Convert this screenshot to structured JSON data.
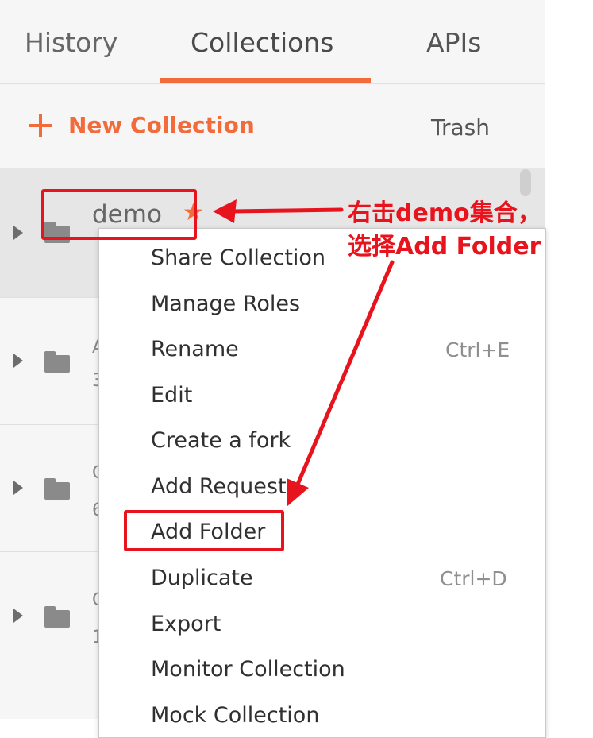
{
  "tabs": {
    "history": "History",
    "collections": "Collections",
    "apis": "APIs",
    "active": "Collections"
  },
  "toolbar": {
    "new_collection_label": "New Collection",
    "trash_label": "Trash"
  },
  "collections": [
    {
      "name": "demo",
      "favorite": true,
      "icon": "folder-icon"
    },
    {
      "name_stub": "A",
      "sub_stub": "3"
    },
    {
      "name_stub": "C",
      "sub_stub": "6"
    },
    {
      "name_stub": "C",
      "sub_stub": "1"
    }
  ],
  "context_menu": {
    "items": [
      {
        "label": "Share Collection",
        "shortcut": ""
      },
      {
        "label": "Manage Roles",
        "shortcut": ""
      },
      {
        "label": "Rename",
        "shortcut": "Ctrl+E"
      },
      {
        "label": "Edit",
        "shortcut": ""
      },
      {
        "label": "Create a fork",
        "shortcut": ""
      },
      {
        "label": "Add Request",
        "shortcut": ""
      },
      {
        "label": "Add Folder",
        "shortcut": "",
        "highlighted": true
      },
      {
        "label": "Duplicate",
        "shortcut": "Ctrl+D"
      },
      {
        "label": "Export",
        "shortcut": ""
      },
      {
        "label": "Monitor Collection",
        "shortcut": ""
      },
      {
        "label": "Mock Collection",
        "shortcut": ""
      }
    ]
  },
  "annotation": {
    "line1": "右击demo集合，",
    "line2": "选择Add Folder",
    "color": "#e8141d"
  },
  "colors": {
    "accent": "#f26b3a",
    "annotation_red": "#e8141d"
  }
}
